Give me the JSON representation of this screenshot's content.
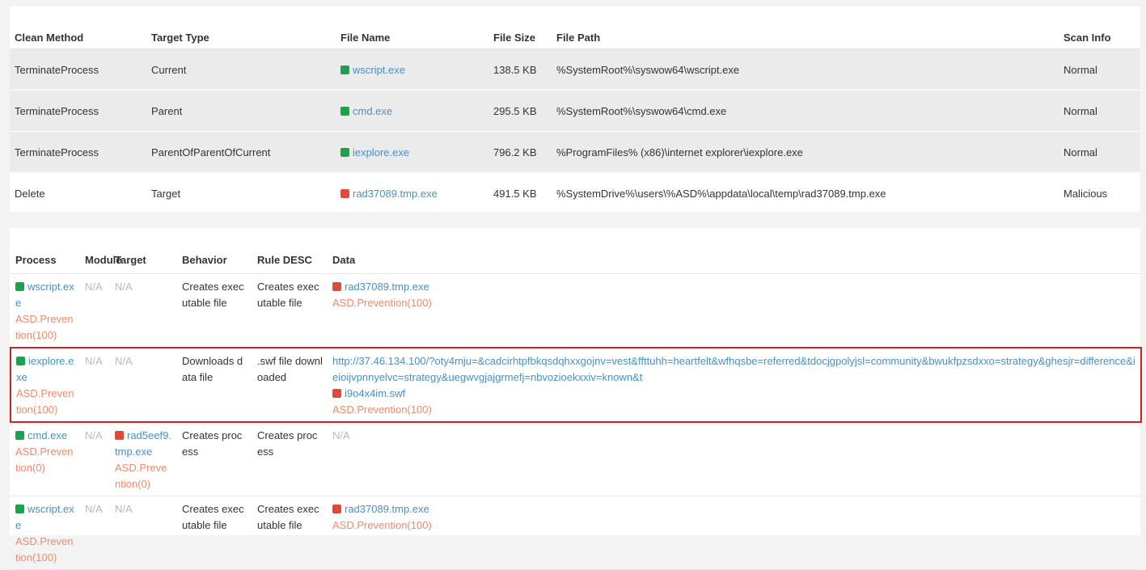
{
  "clean_table": {
    "headers": [
      "Clean Method",
      "Target Type",
      "File Name",
      "File Size",
      "File Path",
      "Scan Info"
    ],
    "rows": [
      {
        "method": "TerminateProcess",
        "target_type": "Current",
        "file_name": "wscript.exe",
        "file_status": "green",
        "file_size": "138.5 KB",
        "file_path": "%SystemRoot%\\syswow64\\wscript.exe",
        "scan_info": "Normal"
      },
      {
        "method": "TerminateProcess",
        "target_type": "Parent",
        "file_name": "cmd.exe",
        "file_status": "green",
        "file_size": "295.5 KB",
        "file_path": "%SystemRoot%\\syswow64\\cmd.exe",
        "scan_info": "Normal"
      },
      {
        "method": "TerminateProcess",
        "target_type": "ParentOfParentOfCurrent",
        "file_name": "iexplore.exe",
        "file_status": "green",
        "file_size": "796.2 KB",
        "file_path": "%ProgramFiles% (x86)\\internet explorer\\iexplore.exe",
        "scan_info": "Normal"
      },
      {
        "method": "Delete",
        "target_type": "Target",
        "file_name": "rad37089.tmp.exe",
        "file_status": "red",
        "file_size": "491.5 KB",
        "file_path": "%SystemDrive%\\users\\%ASD%\\appdata\\local\\temp\\rad37089.tmp.exe",
        "scan_info": "Malicious"
      }
    ]
  },
  "behavior_table": {
    "headers": [
      "Process",
      "Module",
      "Target",
      "Behavior",
      "Rule DESC",
      "Data"
    ],
    "module_header_lines": [
      "Mod",
      "ule"
    ],
    "rows": [
      {
        "process": "wscript.exe",
        "process_status": "green",
        "process_rule": "ASD.Prevention(100)",
        "module": "N/A",
        "target": "N/A",
        "behavior": "Creates executable file",
        "rule_desc": "Creates executable file",
        "data_url": "",
        "data_file": "rad37089.tmp.exe",
        "data_status": "red",
        "data_rule": "ASD.Prevention(100)",
        "highlight": false
      },
      {
        "process": "iexplore.exe",
        "process_status": "green",
        "process_rule": "ASD.Prevention(100)",
        "module": "N/A",
        "target": "N/A",
        "behavior": "Downloads data file",
        "rule_desc": ".swf file downloaded",
        "data_url": "http://37.46.134.100/?oty4mju=&cadcirhtpfbkqsdqhxxgojnv=vest&ffttuhh=heartfelt&wfhqsbe=referred&tdocjgpolyjsl=community&bwukfpzsdxxo=strategy&ghesjr=difference&ieioijvpnnyelvc=strategy&uegwvgjajgrmefj=nbvozioekxxiv=known&t",
        "data_file": "i9o4x4im.swf",
        "data_status": "red",
        "data_rule": "ASD.Prevention(100)",
        "highlight": true
      },
      {
        "process": "cmd.exe",
        "process_status": "green",
        "process_rule": "ASD.Prevention(0)",
        "module": "N/A",
        "target": "rad5eef9.tmp.exe",
        "target_status": "red",
        "target_rule": "ASD.Prevention(0)",
        "behavior": "Creates process",
        "rule_desc": "Creates process",
        "data_na": "N/A",
        "highlight": false
      },
      {
        "process": "wscript.exe",
        "process_status": "green",
        "process_rule": "ASD.Prevention(100)",
        "module": "N/A",
        "target": "N/A",
        "behavior": "Creates executable file",
        "rule_desc": "Creates executable file",
        "data_url": "",
        "data_file": "rad37089.tmp.exe",
        "data_status": "red",
        "data_rule": "ASD.Prevention(100)",
        "highlight": false
      }
    ]
  },
  "colors": {
    "normal_icon": "#1aa34a",
    "malicious_icon": "#e04a37",
    "link": "#4a8fc7",
    "rule_text": "#ef8a6c",
    "highlight_border": "#d51f26"
  },
  "icons": {
    "normal": "green-square-icon",
    "malicious": "red-square-icon"
  }
}
